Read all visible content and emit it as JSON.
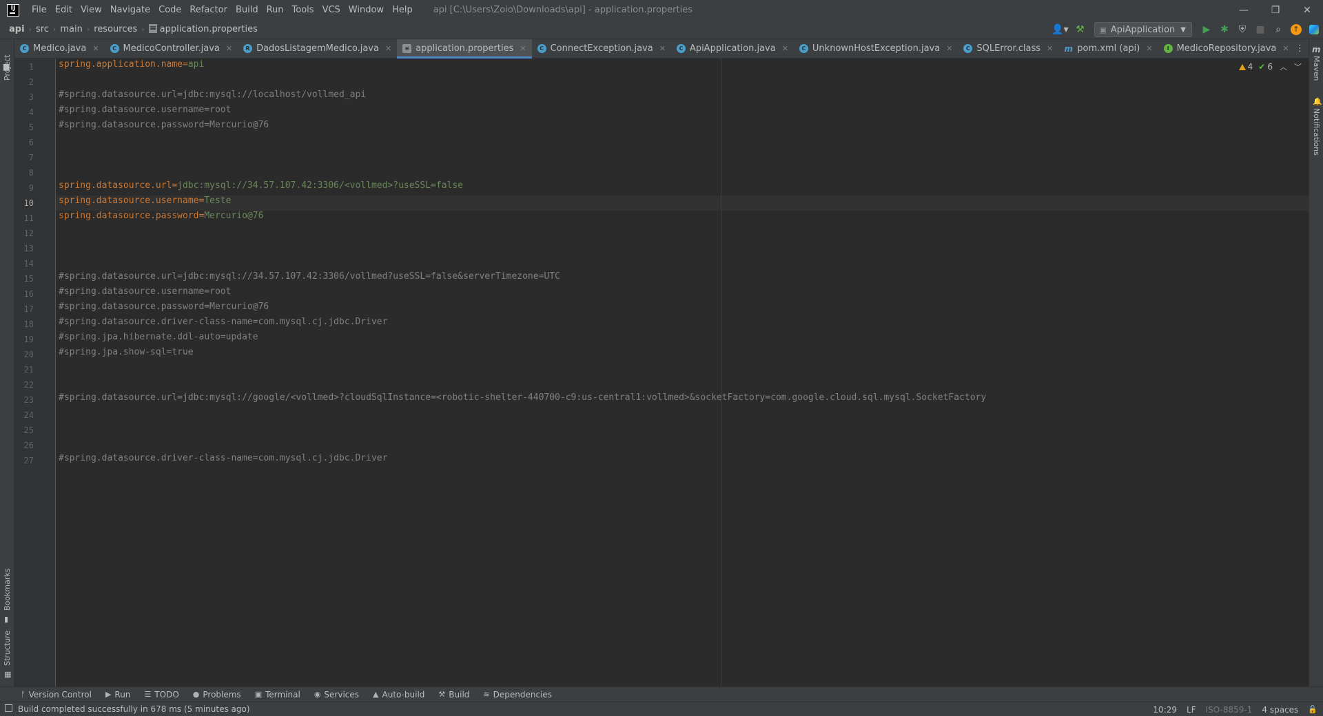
{
  "titlebar": {
    "logo": "IJ",
    "menu": [
      "File",
      "Edit",
      "View",
      "Navigate",
      "Code",
      "Refactor",
      "Build",
      "Run",
      "Tools",
      "VCS",
      "Window",
      "Help"
    ],
    "window_title": "api [C:\\Users\\Zoio\\Downloads\\api] - application.properties"
  },
  "navbar": {
    "breadcrumb": [
      "api",
      "src",
      "main",
      "resources",
      "application.properties"
    ],
    "run_configuration": "ApiApplication"
  },
  "stripes": {
    "left_top": "Project",
    "left_bookmarks": "Bookmarks",
    "left_structure": "Structure",
    "right_maven": "Maven",
    "right_notifications": "Notifications"
  },
  "tabs": [
    {
      "label": "Medico.java",
      "icon": "class-icon",
      "color": "#4a9ec9"
    },
    {
      "label": "MedicoController.java",
      "icon": "class-icon",
      "color": "#4a9ec9"
    },
    {
      "label": "DadosListagemMedico.java",
      "icon": "record-icon",
      "color": "#4a9ec9"
    },
    {
      "label": "application.properties",
      "icon": "properties-icon",
      "color": "#8e8e8e",
      "active": true
    },
    {
      "label": "ConnectException.java",
      "icon": "class-icon",
      "color": "#4a9ec9"
    },
    {
      "label": "ApiApplication.java",
      "icon": "class-icon",
      "color": "#4a9ec9"
    },
    {
      "label": "UnknownHostException.java",
      "icon": "class-icon",
      "color": "#4a9ec9"
    },
    {
      "label": "SQLError.class",
      "icon": "class-icon",
      "color": "#4a9ec9"
    },
    {
      "label": "pom.xml (api)",
      "icon": "maven-icon",
      "color": "#4a9ec9"
    },
    {
      "label": "MedicoRepository.java",
      "icon": "interface-icon",
      "color": "#62b543"
    }
  ],
  "editor": {
    "current_line": 10,
    "inspections": {
      "warnings": "4",
      "checks": "6"
    },
    "lines": [
      {
        "n": "1",
        "type": "prop",
        "key": "spring.application.name=",
        "val": "api"
      },
      {
        "n": "2",
        "type": "empty"
      },
      {
        "n": "3",
        "type": "comment",
        "text": "#spring.datasource.url=jdbc:mysql://localhost/vollmed_api"
      },
      {
        "n": "4",
        "type": "comment",
        "text": "#spring.datasource.username=root"
      },
      {
        "n": "5",
        "type": "comment",
        "text": "#spring.datasource.password=Mercurio@76"
      },
      {
        "n": "6",
        "type": "empty"
      },
      {
        "n": "7",
        "type": "empty"
      },
      {
        "n": "8",
        "type": "empty"
      },
      {
        "n": "9",
        "type": "prop",
        "key": "spring.datasource.url=",
        "val": "jdbc:mysql://34.57.107.42:3306/<vollmed>?useSSL=false"
      },
      {
        "n": "10",
        "type": "prop",
        "key": "spring.datasource.username=",
        "val": "Teste"
      },
      {
        "n": "11",
        "type": "prop",
        "key": "spring.datasource.password=",
        "val": "Mercurio@76"
      },
      {
        "n": "12",
        "type": "empty"
      },
      {
        "n": "13",
        "type": "empty"
      },
      {
        "n": "14",
        "type": "empty"
      },
      {
        "n": "15",
        "type": "comment",
        "text": "#spring.datasource.url=jdbc:mysql://34.57.107.42:3306/vollmed?useSSL=false&serverTimezone=UTC"
      },
      {
        "n": "16",
        "type": "comment",
        "text": "#spring.datasource.username=root"
      },
      {
        "n": "17",
        "type": "comment",
        "text": "#spring.datasource.password=Mercurio@76"
      },
      {
        "n": "18",
        "type": "comment",
        "text": "#spring.datasource.driver-class-name=com.mysql.cj.jdbc.Driver"
      },
      {
        "n": "19",
        "type": "comment",
        "text": "#spring.jpa.hibernate.ddl-auto=update"
      },
      {
        "n": "20",
        "type": "comment",
        "text": "#spring.jpa.show-sql=true"
      },
      {
        "n": "21",
        "type": "empty"
      },
      {
        "n": "22",
        "type": "empty"
      },
      {
        "n": "23",
        "type": "comment",
        "text": "#spring.datasource.url=jdbc:mysql://google/<vollmed>?cloudSqlInstance=<robotic-shelter-440700-c9:us-central1:vollmed>&socketFactory=com.google.cloud.sql.mysql.SocketFactory"
      },
      {
        "n": "24",
        "type": "empty"
      },
      {
        "n": "25",
        "type": "empty"
      },
      {
        "n": "26",
        "type": "empty"
      },
      {
        "n": "27",
        "type": "comment",
        "text": "#spring.datasource.driver-class-name=com.mysql.cj.jdbc.Driver"
      }
    ]
  },
  "bottom_tools": [
    {
      "label": "Version Control",
      "icon": "branch-icon",
      "glyph": "ᚠ"
    },
    {
      "label": "Run",
      "icon": "run-icon",
      "glyph": "▶"
    },
    {
      "label": "TODO",
      "icon": "todo-icon",
      "glyph": "☰"
    },
    {
      "label": "Problems",
      "icon": "problems-icon",
      "glyph": "●"
    },
    {
      "label": "Terminal",
      "icon": "terminal-icon",
      "glyph": "▣"
    },
    {
      "label": "Services",
      "icon": "services-icon",
      "glyph": "◉"
    },
    {
      "label": "Auto-build",
      "icon": "warning-icon",
      "glyph": "▲"
    },
    {
      "label": "Build",
      "icon": "hammer-icon",
      "glyph": "⚒"
    },
    {
      "label": "Dependencies",
      "icon": "layers-icon",
      "glyph": "≋"
    }
  ],
  "statusbar": {
    "message": "Build completed successfully in 678 ms (5 minutes ago)",
    "position": "10:29",
    "line_separator": "LF",
    "encoding": "ISO-8859-1",
    "indent": "4 spaces"
  },
  "colors": {
    "background": "#2b2b2b",
    "panel": "#3c3f41",
    "comment": "#808080",
    "key": "#cc7832",
    "value": "#6a8759",
    "accent": "#4a88c7"
  }
}
